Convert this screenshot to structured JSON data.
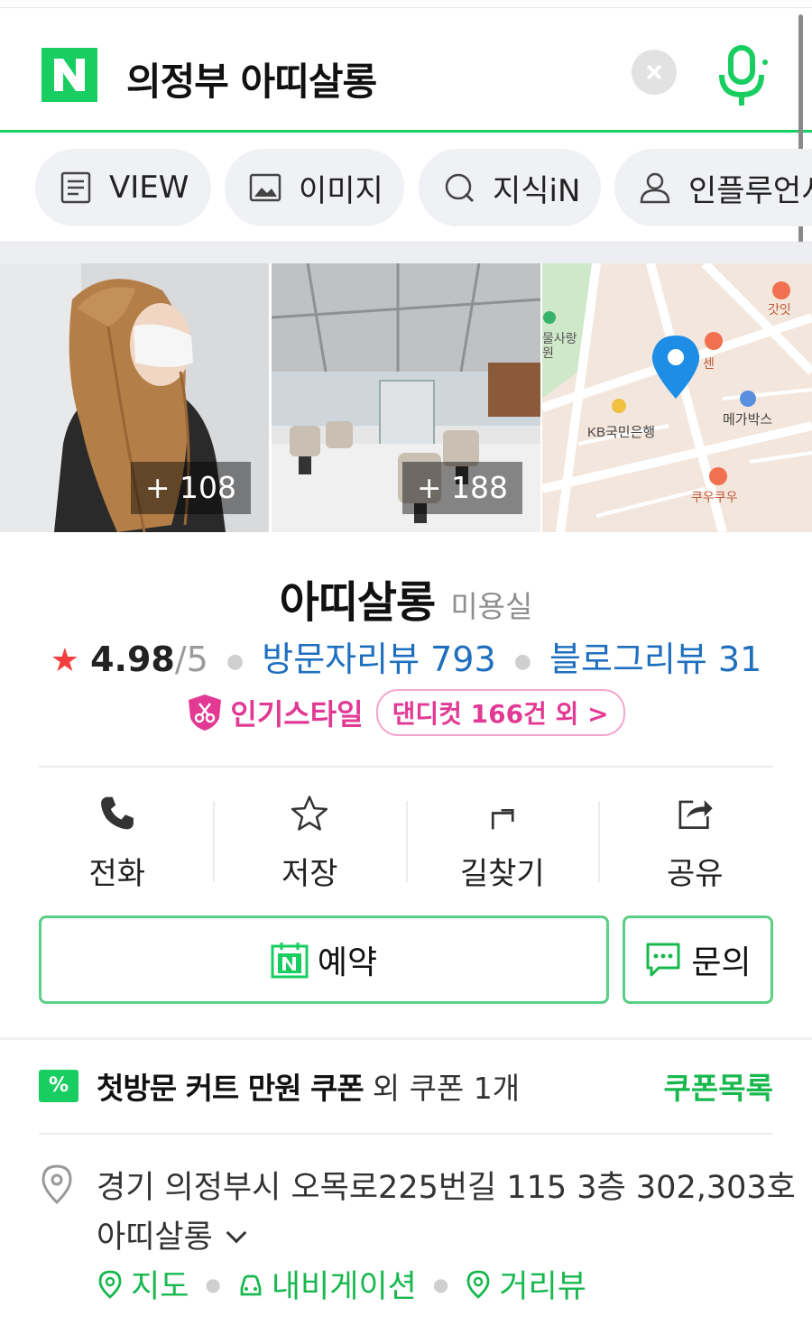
{
  "search": {
    "query": "의정부 아띠살롱",
    "logo_letter": "N"
  },
  "tabs": [
    {
      "label": "VIEW",
      "icon": "document-icon"
    },
    {
      "label": "이미지",
      "icon": "image-icon"
    },
    {
      "label": "지식iN",
      "icon": "knowledge-icon"
    },
    {
      "label": "인플루언서",
      "icon": "person-icon"
    }
  ],
  "photos": {
    "photo1_count": "+ 108",
    "photo2_count": "+ 188",
    "map_labels": {
      "park": "물사랑\n원",
      "bank": "KB국민은행",
      "cinema": "메가박스",
      "food1": "갓잇",
      "food2": "쿠우쿠우",
      "poi": "센"
    }
  },
  "place": {
    "name": "아띠살롱",
    "category": "미용실",
    "star": "★",
    "score": "4.98",
    "score_max": "/5",
    "visitor_reviews": "방문자리뷰 793",
    "blog_reviews": "블로그리뷰 31",
    "popular_style_label": "인기스타일",
    "popular_style_pill": "댄디컷 166건 외 >"
  },
  "actions": [
    {
      "label": "전화",
      "icon": "phone-icon"
    },
    {
      "label": "저장",
      "icon": "star-icon"
    },
    {
      "label": "길찾기",
      "icon": "directions-icon"
    },
    {
      "label": "공유",
      "icon": "share-icon"
    }
  ],
  "buttons": {
    "reserve": "예약",
    "ask": "문의"
  },
  "coupon": {
    "icon_text": "%",
    "main": "첫방문 커트 만원 쿠폰",
    "extra": "외 쿠폰 1개",
    "list_link": "쿠폰목록"
  },
  "address": {
    "line1": "경기 의정부시 오목로225번길 115 3층 302,303호",
    "line2": "아띠살롱",
    "links": {
      "map": "지도",
      "navigation": "내비게이션",
      "street_view": "거리뷰"
    }
  },
  "colors": {
    "naver_green": "#19ce60",
    "link_blue": "#1f6fbf",
    "pink": "#e23a94",
    "star_red": "#f0413f"
  }
}
